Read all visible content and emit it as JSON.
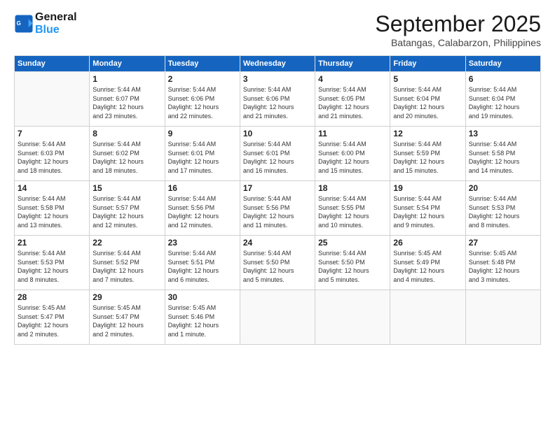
{
  "header": {
    "logo_line1": "General",
    "logo_line2": "Blue",
    "month": "September 2025",
    "location": "Batangas, Calabarzon, Philippines"
  },
  "weekdays": [
    "Sunday",
    "Monday",
    "Tuesday",
    "Wednesday",
    "Thursday",
    "Friday",
    "Saturday"
  ],
  "weeks": [
    [
      {
        "day": "",
        "info": ""
      },
      {
        "day": "1",
        "info": "Sunrise: 5:44 AM\nSunset: 6:07 PM\nDaylight: 12 hours\nand 23 minutes."
      },
      {
        "day": "2",
        "info": "Sunrise: 5:44 AM\nSunset: 6:06 PM\nDaylight: 12 hours\nand 22 minutes."
      },
      {
        "day": "3",
        "info": "Sunrise: 5:44 AM\nSunset: 6:06 PM\nDaylight: 12 hours\nand 21 minutes."
      },
      {
        "day": "4",
        "info": "Sunrise: 5:44 AM\nSunset: 6:05 PM\nDaylight: 12 hours\nand 21 minutes."
      },
      {
        "day": "5",
        "info": "Sunrise: 5:44 AM\nSunset: 6:04 PM\nDaylight: 12 hours\nand 20 minutes."
      },
      {
        "day": "6",
        "info": "Sunrise: 5:44 AM\nSunset: 6:04 PM\nDaylight: 12 hours\nand 19 minutes."
      }
    ],
    [
      {
        "day": "7",
        "info": "Sunrise: 5:44 AM\nSunset: 6:03 PM\nDaylight: 12 hours\nand 18 minutes."
      },
      {
        "day": "8",
        "info": "Sunrise: 5:44 AM\nSunset: 6:02 PM\nDaylight: 12 hours\nand 18 minutes."
      },
      {
        "day": "9",
        "info": "Sunrise: 5:44 AM\nSunset: 6:01 PM\nDaylight: 12 hours\nand 17 minutes."
      },
      {
        "day": "10",
        "info": "Sunrise: 5:44 AM\nSunset: 6:01 PM\nDaylight: 12 hours\nand 16 minutes."
      },
      {
        "day": "11",
        "info": "Sunrise: 5:44 AM\nSunset: 6:00 PM\nDaylight: 12 hours\nand 15 minutes."
      },
      {
        "day": "12",
        "info": "Sunrise: 5:44 AM\nSunset: 5:59 PM\nDaylight: 12 hours\nand 15 minutes."
      },
      {
        "day": "13",
        "info": "Sunrise: 5:44 AM\nSunset: 5:58 PM\nDaylight: 12 hours\nand 14 minutes."
      }
    ],
    [
      {
        "day": "14",
        "info": "Sunrise: 5:44 AM\nSunset: 5:58 PM\nDaylight: 12 hours\nand 13 minutes."
      },
      {
        "day": "15",
        "info": "Sunrise: 5:44 AM\nSunset: 5:57 PM\nDaylight: 12 hours\nand 12 minutes."
      },
      {
        "day": "16",
        "info": "Sunrise: 5:44 AM\nSunset: 5:56 PM\nDaylight: 12 hours\nand 12 minutes."
      },
      {
        "day": "17",
        "info": "Sunrise: 5:44 AM\nSunset: 5:56 PM\nDaylight: 12 hours\nand 11 minutes."
      },
      {
        "day": "18",
        "info": "Sunrise: 5:44 AM\nSunset: 5:55 PM\nDaylight: 12 hours\nand 10 minutes."
      },
      {
        "day": "19",
        "info": "Sunrise: 5:44 AM\nSunset: 5:54 PM\nDaylight: 12 hours\nand 9 minutes."
      },
      {
        "day": "20",
        "info": "Sunrise: 5:44 AM\nSunset: 5:53 PM\nDaylight: 12 hours\nand 8 minutes."
      }
    ],
    [
      {
        "day": "21",
        "info": "Sunrise: 5:44 AM\nSunset: 5:53 PM\nDaylight: 12 hours\nand 8 minutes."
      },
      {
        "day": "22",
        "info": "Sunrise: 5:44 AM\nSunset: 5:52 PM\nDaylight: 12 hours\nand 7 minutes."
      },
      {
        "day": "23",
        "info": "Sunrise: 5:44 AM\nSunset: 5:51 PM\nDaylight: 12 hours\nand 6 minutes."
      },
      {
        "day": "24",
        "info": "Sunrise: 5:44 AM\nSunset: 5:50 PM\nDaylight: 12 hours\nand 5 minutes."
      },
      {
        "day": "25",
        "info": "Sunrise: 5:44 AM\nSunset: 5:50 PM\nDaylight: 12 hours\nand 5 minutes."
      },
      {
        "day": "26",
        "info": "Sunrise: 5:45 AM\nSunset: 5:49 PM\nDaylight: 12 hours\nand 4 minutes."
      },
      {
        "day": "27",
        "info": "Sunrise: 5:45 AM\nSunset: 5:48 PM\nDaylight: 12 hours\nand 3 minutes."
      }
    ],
    [
      {
        "day": "28",
        "info": "Sunrise: 5:45 AM\nSunset: 5:47 PM\nDaylight: 12 hours\nand 2 minutes."
      },
      {
        "day": "29",
        "info": "Sunrise: 5:45 AM\nSunset: 5:47 PM\nDaylight: 12 hours\nand 2 minutes."
      },
      {
        "day": "30",
        "info": "Sunrise: 5:45 AM\nSunset: 5:46 PM\nDaylight: 12 hours\nand 1 minute."
      },
      {
        "day": "",
        "info": ""
      },
      {
        "day": "",
        "info": ""
      },
      {
        "day": "",
        "info": ""
      },
      {
        "day": "",
        "info": ""
      }
    ]
  ]
}
